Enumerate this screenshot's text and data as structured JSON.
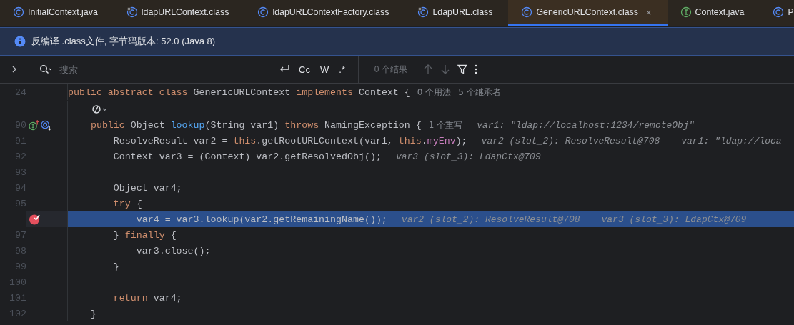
{
  "tabs": [
    {
      "label": "InitialContext.java",
      "kind": "class",
      "selected": false
    },
    {
      "label": "ldapURLContext.class",
      "kind": "class-locked",
      "selected": false
    },
    {
      "label": "ldapURLContextFactory.class",
      "kind": "class",
      "selected": false
    },
    {
      "label": "LdapURL.class",
      "kind": "class-locked",
      "selected": false
    },
    {
      "label": "GenericURLContext.class",
      "kind": "class",
      "selected": true,
      "close": "×"
    },
    {
      "label": "Context.java",
      "kind": "interface",
      "selected": false
    },
    {
      "label": "P",
      "kind": "class",
      "selected": false
    }
  ],
  "notice": {
    "text": "反编译 .class文件, 字节码版本: 52.0 (Java 8)"
  },
  "search": {
    "placeholder": "搜索",
    "options": [
      "Cc",
      "W",
      ".*"
    ],
    "results": "0 个结果"
  },
  "editor": {
    "sticky_line": {
      "number": "24",
      "tokens": [
        {
          "text": "public abstract class ",
          "kind": "kw"
        },
        {
          "text": "GenericURLContext ",
          "kind": "plain"
        },
        {
          "text": "implements",
          "kind": "kw"
        },
        {
          "text": " Context {",
          "kind": "plain"
        }
      ],
      "notes": [
        "0 个用法",
        "5 个继承者"
      ]
    },
    "lines": [
      {
        "kind": "inlay",
        "breakpoint": false,
        "current": false
      },
      {
        "kind": "code",
        "number": "90",
        "breakpoint": false,
        "current": false,
        "gutter": [
          {
            "kind": "implements"
          },
          {
            "kind": "overridden"
          }
        ],
        "tokens": [
          {
            "text": "    public",
            "kind": "kw"
          },
          {
            "text": " Object ",
            "kind": "plain"
          },
          {
            "text": "lookup",
            "kind": "fn"
          },
          {
            "text": "(String var1) ",
            "kind": "plain"
          },
          {
            "text": "throws",
            "kind": "kw"
          },
          {
            "text": " NamingException {",
            "kind": "plain"
          }
        ],
        "notes": [
          "1 个重写"
        ],
        "hints": [
          "var1: \"ldap://localhost:1234/remoteObj\""
        ]
      },
      {
        "kind": "code",
        "number": "91",
        "breakpoint": false,
        "current": false,
        "tokens": [
          {
            "text": "        ResolveResult var2 = ",
            "kind": "plain"
          },
          {
            "text": "this",
            "kind": "kw"
          },
          {
            "text": ".getRootURLContext(var1, ",
            "kind": "plain"
          },
          {
            "text": "this",
            "kind": "kw"
          },
          {
            "text": ".",
            "kind": "plain"
          },
          {
            "text": "myEnv",
            "kind": "field"
          },
          {
            "text": ");",
            "kind": "plain"
          }
        ],
        "hints": [
          "var2 (slot_2): ResolveResult@708",
          "var1: \"ldap://loca"
        ]
      },
      {
        "kind": "code",
        "number": "92",
        "breakpoint": false,
        "current": false,
        "tokens": [
          {
            "text": "        Context var3 = (Context) var2.getResolvedObj();",
            "kind": "plain"
          }
        ],
        "hints": [
          "var3 (slot_3): LdapCtx@709"
        ]
      },
      {
        "kind": "code",
        "number": "93",
        "breakpoint": false,
        "current": false
      },
      {
        "kind": "code",
        "number": "94",
        "breakpoint": false,
        "current": false,
        "tokens": [
          {
            "text": "        Object var4;",
            "kind": "plain"
          }
        ]
      },
      {
        "kind": "code",
        "number": "95",
        "breakpoint": false,
        "current": false,
        "tokens": [
          {
            "text": "        try",
            "kind": "kw"
          },
          {
            "text": " {",
            "kind": "plain"
          }
        ]
      },
      {
        "kind": "code",
        "breakpoint": true,
        "current": true,
        "tokens": [
          {
            "text": "            var4 = var3.lookup(var2.getRemainingName());",
            "kind": "plain"
          }
        ],
        "hints": [
          "var2 (slot_2): ResolveResult@708",
          "var3 (slot_3): LdapCtx@709"
        ]
      },
      {
        "kind": "code",
        "number": "97",
        "breakpoint": false,
        "current": false,
        "tokens": [
          {
            "text": "        }",
            "kind": "plain"
          },
          {
            "text": " finally",
            "kind": "kw"
          },
          {
            "text": " {",
            "kind": "plain"
          }
        ]
      },
      {
        "kind": "code",
        "number": "98",
        "breakpoint": false,
        "current": false,
        "tokens": [
          {
            "text": "            var3.close();",
            "kind": "plain"
          }
        ]
      },
      {
        "kind": "code",
        "number": "99",
        "breakpoint": false,
        "current": false,
        "tokens": [
          {
            "text": "        }",
            "kind": "plain"
          }
        ]
      },
      {
        "kind": "code",
        "number": "100",
        "breakpoint": false,
        "current": false
      },
      {
        "kind": "code",
        "number": "101",
        "breakpoint": false,
        "current": false,
        "tokens": [
          {
            "text": "        return",
            "kind": "kw"
          },
          {
            "text": " var4;",
            "kind": "plain"
          }
        ]
      },
      {
        "kind": "code",
        "number": "102",
        "breakpoint": false,
        "current": false,
        "tokens": [
          {
            "text": "    }",
            "kind": "plain"
          }
        ]
      }
    ]
  }
}
